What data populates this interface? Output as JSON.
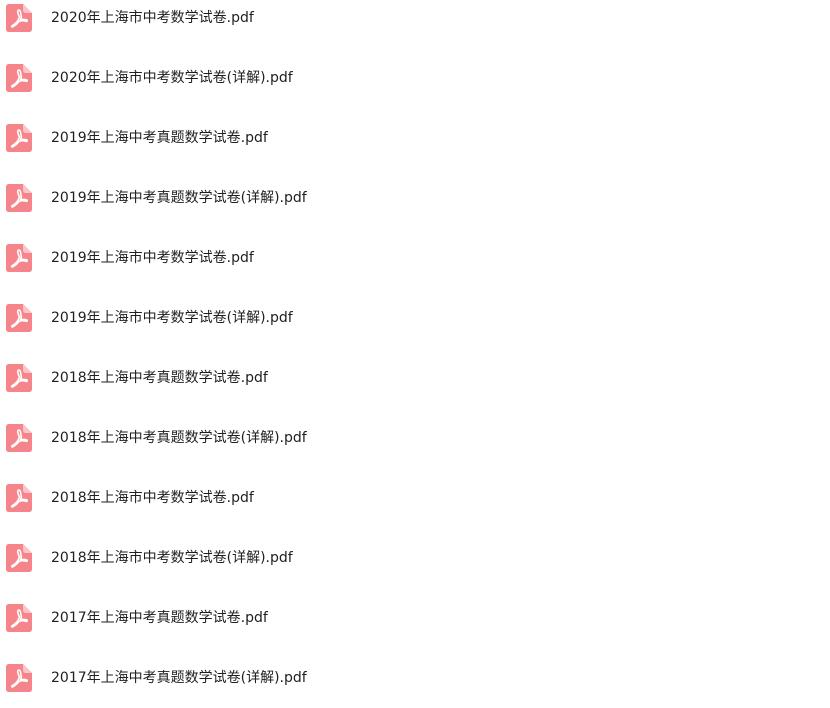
{
  "files": [
    {
      "name": "2020年上海市中考数学试卷.pdf",
      "icon": "pdf-icon"
    },
    {
      "name": "2020年上海市中考数学试卷(详解).pdf",
      "icon": "pdf-icon"
    },
    {
      "name": "2019年上海中考真题数学试卷.pdf",
      "icon": "pdf-icon"
    },
    {
      "name": "2019年上海中考真题数学试卷(详解).pdf",
      "icon": "pdf-icon"
    },
    {
      "name": "2019年上海市中考数学试卷.pdf",
      "icon": "pdf-icon"
    },
    {
      "name": "2019年上海市中考数学试卷(详解).pdf",
      "icon": "pdf-icon"
    },
    {
      "name": "2018年上海中考真题数学试卷.pdf",
      "icon": "pdf-icon"
    },
    {
      "name": "2018年上海中考真题数学试卷(详解).pdf",
      "icon": "pdf-icon"
    },
    {
      "name": "2018年上海市中考数学试卷.pdf",
      "icon": "pdf-icon"
    },
    {
      "name": "2018年上海市中考数学试卷(详解).pdf",
      "icon": "pdf-icon"
    },
    {
      "name": "2017年上海中考真题数学试卷.pdf",
      "icon": "pdf-icon"
    },
    {
      "name": "2017年上海中考真题数学试卷(详解).pdf",
      "icon": "pdf-icon"
    }
  ],
  "colors": {
    "pdf_icon": "#f6858b",
    "text": "#1f1f1f"
  }
}
